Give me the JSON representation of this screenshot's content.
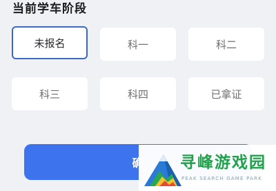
{
  "section_title": "当前学车阶段",
  "options": [
    {
      "label": "未报名",
      "selected": true
    },
    {
      "label": "科一",
      "selected": false
    },
    {
      "label": "科二",
      "selected": false
    },
    {
      "label": "科三",
      "selected": false
    },
    {
      "label": "科四",
      "selected": false
    },
    {
      "label": "已拿证",
      "selected": false
    }
  ],
  "confirm_button": {
    "label": "确"
  },
  "watermark": {
    "title": "寻峰游戏园",
    "subtitle": "PEAK SEARCH GAME PARK",
    "logo_icon": "mountain-peak-logo-icon"
  },
  "colors": {
    "accent": "#3e73ee",
    "selected_border": "#3b68c8",
    "background": "#f0f1f4",
    "watermark_green": "#22a14c"
  }
}
